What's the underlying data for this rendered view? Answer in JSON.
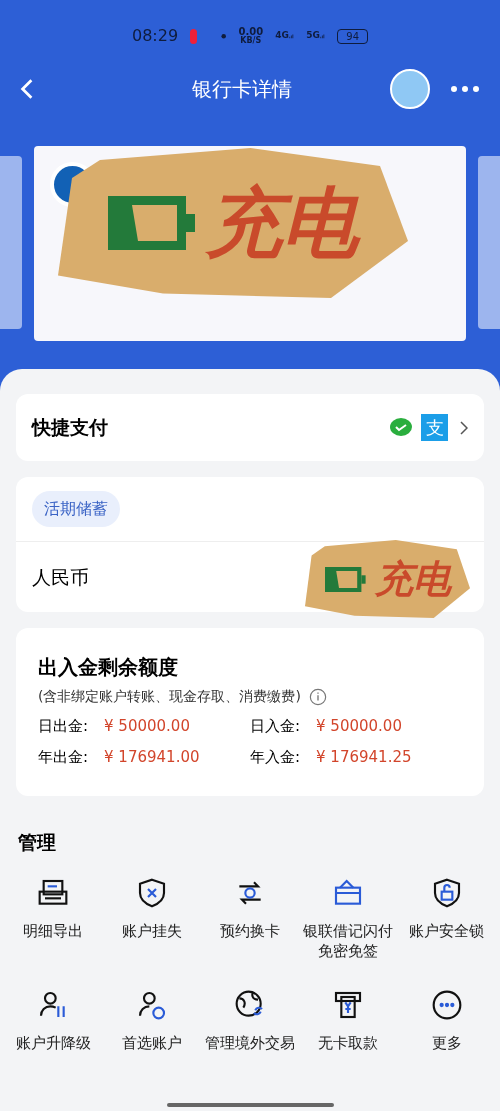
{
  "status_bar": {
    "time": "08:29",
    "speed": "0.00",
    "speed_unit": "KB/S",
    "net1": "4G",
    "net2": "5G",
    "battery": "94"
  },
  "header": {
    "title": "银行卡详情"
  },
  "stickers": [
    {
      "text": "充电"
    },
    {
      "text": "充电"
    }
  ],
  "quick_pay": {
    "label": "快捷支付",
    "alipay": "支"
  },
  "deposit": {
    "tag": "活期储蓄",
    "currency": "人民币"
  },
  "limits": {
    "title": "出入金剩余额度",
    "note": "(含非绑定账户转账、现金存取、消费缴费)",
    "items": [
      {
        "label": "日出金:",
        "value": "¥ 50000.00"
      },
      {
        "label": "日入金:",
        "value": "¥ 50000.00"
      },
      {
        "label": "年出金:",
        "value": "¥ 176941.00"
      },
      {
        "label": "年入金:",
        "value": "¥ 176941.25"
      }
    ]
  },
  "manage": {
    "title": "管理",
    "items": [
      {
        "label": "明细导出"
      },
      {
        "label": "账户挂失"
      },
      {
        "label": "预约换卡"
      },
      {
        "label": "银联借记闪付免密免签"
      },
      {
        "label": "账户安全锁"
      },
      {
        "label": "账户升降级"
      },
      {
        "label": "首选账户"
      },
      {
        "label": "管理境外交易"
      },
      {
        "label": "无卡取款"
      },
      {
        "label": "更多"
      }
    ]
  }
}
